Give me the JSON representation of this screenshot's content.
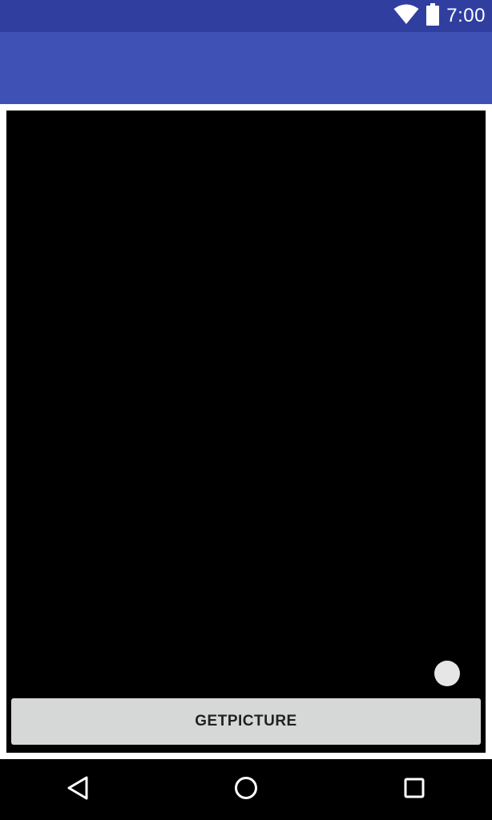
{
  "status_bar": {
    "time": "7:00",
    "icons": [
      "wifi-icon",
      "battery-icon"
    ]
  },
  "colors": {
    "status_bar": "#303f9f",
    "app_bar": "#3f51b5",
    "preview": "#000000",
    "button": "#d6d7d7"
  },
  "main": {
    "button_label": "GETPICTURE"
  },
  "nav_bar": {
    "icons": [
      "back-icon",
      "home-icon",
      "recent-apps-icon"
    ]
  }
}
